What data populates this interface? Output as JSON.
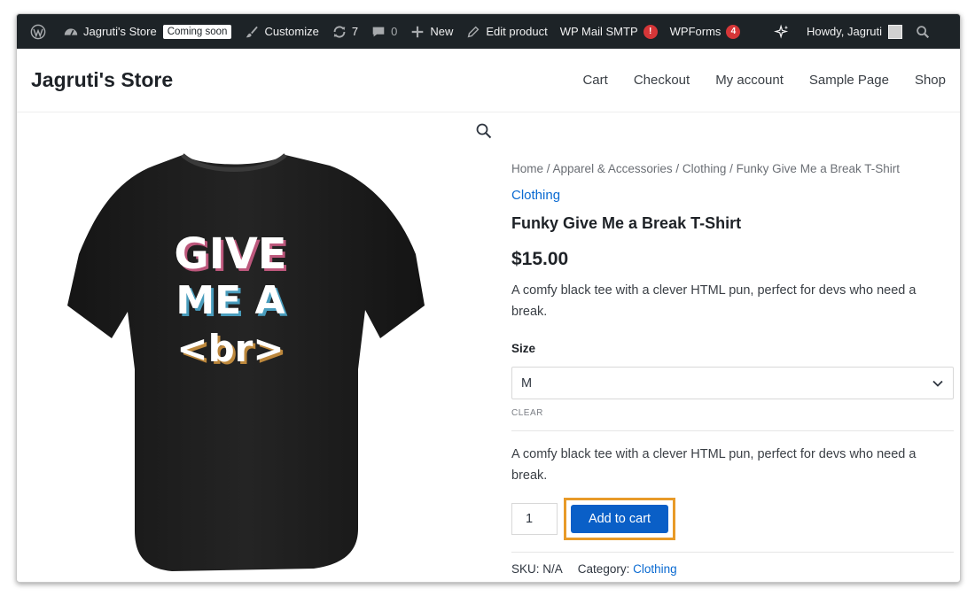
{
  "adminbar": {
    "site_name": "Jagruti's Store",
    "coming_soon": "Coming soon",
    "customize": "Customize",
    "updates_count": "7",
    "comments_count": "0",
    "new_label": "New",
    "edit_product": "Edit product",
    "wp_mail_smtp": "WP Mail SMTP",
    "wp_mail_smtp_badge": "!",
    "wpforms": "WPForms",
    "wpforms_badge": "4",
    "howdy": "Howdy, Jagruti"
  },
  "header": {
    "site_title": "Jagruti's Store",
    "nav": [
      "Cart",
      "Checkout",
      "My account",
      "Sample Page",
      "Shop"
    ]
  },
  "product": {
    "breadcrumb": [
      "Home",
      "Apparel & Accessories",
      "Clothing",
      "Funky Give Me a Break T-Shirt"
    ],
    "breadcrumb_sep": " / ",
    "category_link": "Clothing",
    "title": "Funky Give Me a Break T-Shirt",
    "price": "$15.00",
    "short_description": "A comfy black tee with a clever HTML pun, perfect for devs who need a break.",
    "size_label": "Size",
    "size_selected": "M",
    "clear_label": "CLEAR",
    "variation_description": "A comfy black tee with a clever HTML pun, perfect for devs who need a break.",
    "quantity": "1",
    "add_to_cart": "Add to cart",
    "sku_label": "SKU:",
    "sku_value": "N/A",
    "category_label": "Category:",
    "category_value": "Clothing",
    "shirt_text": [
      "GIVE",
      "ME A",
      "<br>"
    ]
  },
  "colors": {
    "adminbar_bg": "#1d2327",
    "link_blue": "#0a6ad1",
    "button_blue": "#0a5fc7",
    "highlight_orange": "#e89a28",
    "badge_red": "#d63638"
  }
}
